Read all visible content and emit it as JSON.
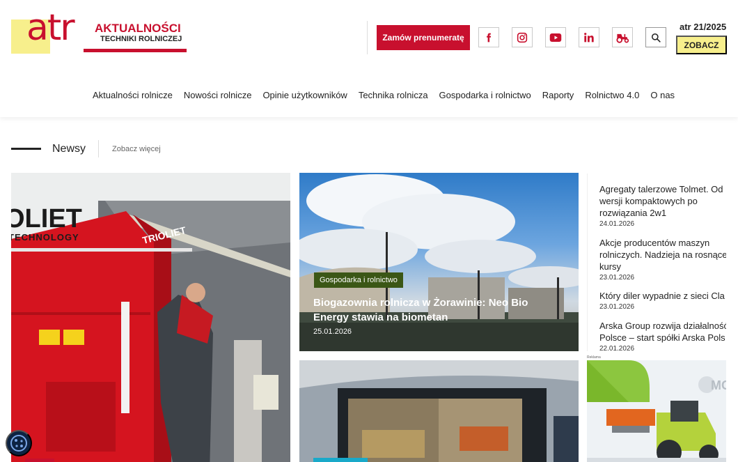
{
  "logo": {
    "mark": "atr",
    "line1": "AKTUALNOŚCI",
    "line2": "TECHNIKI ROLNICZEJ"
  },
  "header": {
    "subscribe_label": "Zamów prenumeratę",
    "issue": "atr 21/2025",
    "zobacz_label": "ZOBACZ",
    "social_icons": [
      "facebook-icon",
      "instagram-icon",
      "youtube-icon",
      "linkedin-icon",
      "tractor-icon"
    ],
    "search_icon": "search-icon"
  },
  "nav": {
    "items": [
      "Aktualności rolnicze",
      "Nowości rolnicze",
      "Opinie użytkowników",
      "Technika rolnicza",
      "Gospodarka i rolnictwo",
      "Raporty",
      "Rolnictwo 4.0",
      "O nas"
    ]
  },
  "section": {
    "title": "Newsy",
    "more": "Zobacz więcej"
  },
  "featured_left": {
    "brand_big": "OLIET",
    "brand_small": "TECHNOLOGY",
    "machine_brand": "TRIOLIET"
  },
  "featured_mid": {
    "category": "Gospodarka i rolnictwo",
    "title": "Biogazownia rolnicza w Żorawinie: Neo Bio Energy stawia na biometan",
    "date": "25.01.2026"
  },
  "news_list": [
    {
      "title_lines": [
        "Agregaty talerzowe Tolmet. Od",
        "wersji kompaktowych po",
        "rozwiązania 2w1"
      ],
      "date": "24.01.2026"
    },
    {
      "title_lines": [
        "Akcje producentów maszyn",
        "rolniczych. Nadzieja na rosnące",
        "kursy"
      ],
      "date": "23.01.2026"
    },
    {
      "title_lines": [
        "Który diler wypadnie z sieci Cla"
      ],
      "date": "23.01.2026"
    },
    {
      "title_lines": [
        "Arska Group rozwija działalność",
        "Polsce – start spółki Arska Pols"
      ],
      "date": "22.01.2026"
    }
  ],
  "ad": {
    "label": "Reklama",
    "brand": "MO"
  },
  "colors": {
    "brand_red": "#c8102e",
    "brand_yellow": "#f7ef8c",
    "category_green": "#3b5716"
  }
}
